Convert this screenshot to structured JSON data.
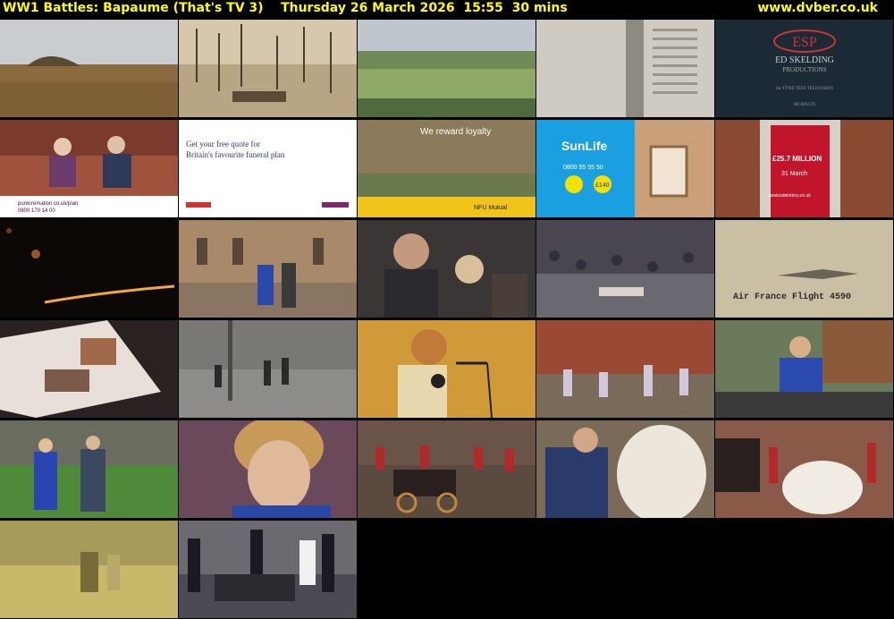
{
  "header": {
    "programme": "WW1 Battles: Bapaume (That's TV 3)",
    "datetime": "Thursday 26 March 2026",
    "time": "15:55",
    "duration": "30 mins",
    "site": "www.dvber.co.uk"
  },
  "thumbnails": [
    {
      "scene": "field-mound"
    },
    {
      "scene": "battlefield-sepia"
    },
    {
      "scene": "green-field"
    },
    {
      "scene": "memorial-wall"
    },
    {
      "scene": "esp-logo",
      "logo_lines": [
        "ESP",
        "ED SKELDING",
        "PRODUCTIONS",
        "for TYNE TEES TELEVISION",
        "MCMXCIX"
      ]
    },
    {
      "scene": "couple-sofa",
      "text": [
        "purecremation.co.uk/plan",
        "0800 170 14 00"
      ]
    },
    {
      "scene": "funeral-ad",
      "text": [
        "Get your free quote for",
        "Britain's favourite funeral plan"
      ]
    },
    {
      "scene": "loyalty-ad",
      "text": [
        "We reward loyalty",
        "NFU Mutual"
      ]
    },
    {
      "scene": "sunlife-ad",
      "text": [
        "SunLife",
        "0800 55 55 50",
        "£140"
      ]
    },
    {
      "scene": "postcode-door",
      "text": [
        "£25.7 MILLION",
        "31 March",
        "postcodelottery.co.uk"
      ]
    },
    {
      "scene": "night-lights"
    },
    {
      "scene": "palace-steps"
    },
    {
      "scene": "crowd-close"
    },
    {
      "scene": "street-crowd"
    },
    {
      "scene": "airplane",
      "text": [
        "Air France Flight 4590"
      ]
    },
    {
      "scene": "photo-album"
    },
    {
      "scene": "soldiers-yard"
    },
    {
      "scene": "speaker-mic"
    },
    {
      "scene": "church-crowd"
    },
    {
      "scene": "diana-street"
    },
    {
      "scene": "couple-lawn"
    },
    {
      "scene": "diana-close"
    },
    {
      "scene": "carriage-guards"
    },
    {
      "scene": "wedding-couple"
    },
    {
      "scene": "wedding-dress"
    },
    {
      "scene": "meadow"
    },
    {
      "scene": "cathedral-car"
    }
  ]
}
